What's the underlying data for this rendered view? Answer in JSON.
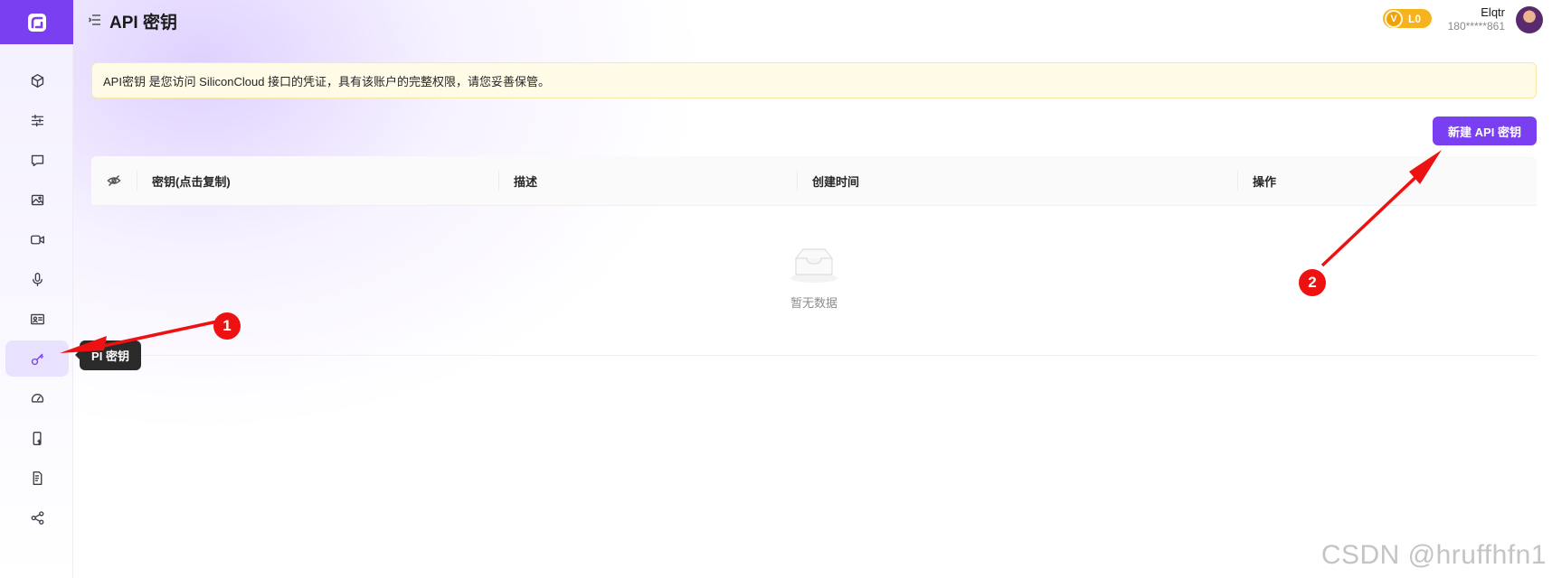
{
  "header": {
    "title": "API 密钥",
    "level_badge": "L0",
    "level_badge_letter": "V",
    "user_name": "Elqtr",
    "user_phone": "180*****861"
  },
  "notice": {
    "text": "API密钥 是您访问 SiliconCloud 接口的凭证，具有该账户的完整权限，请您妥善保管。"
  },
  "actions": {
    "new_key_label": "新建 API 密钥"
  },
  "table": {
    "columns": [
      "密钥(点击复制)",
      "描述",
      "创建时间",
      "操作"
    ],
    "rows": [],
    "empty_text": "暂无数据"
  },
  "sidebar": {
    "items": [
      {
        "icon": "cube-icon"
      },
      {
        "icon": "sliders-icon"
      },
      {
        "icon": "chat-icon"
      },
      {
        "icon": "image-icon"
      },
      {
        "icon": "video-icon"
      },
      {
        "icon": "mic-icon"
      },
      {
        "icon": "id-card-icon"
      },
      {
        "icon": "key-icon",
        "active": true
      },
      {
        "icon": "gauge-icon"
      },
      {
        "icon": "billing-icon"
      },
      {
        "icon": "invoice-icon"
      },
      {
        "icon": "share-icon"
      }
    ],
    "tooltip": "PI 密钥"
  },
  "annotations": {
    "callout_1": "1",
    "callout_2": "2"
  },
  "watermark": "CSDN @hruffhfn1",
  "colors": {
    "accent": "#7b3ff2",
    "notice_bg": "#fffbe7",
    "badge": "#f6b31e",
    "annotation_red": "#ee1111"
  }
}
